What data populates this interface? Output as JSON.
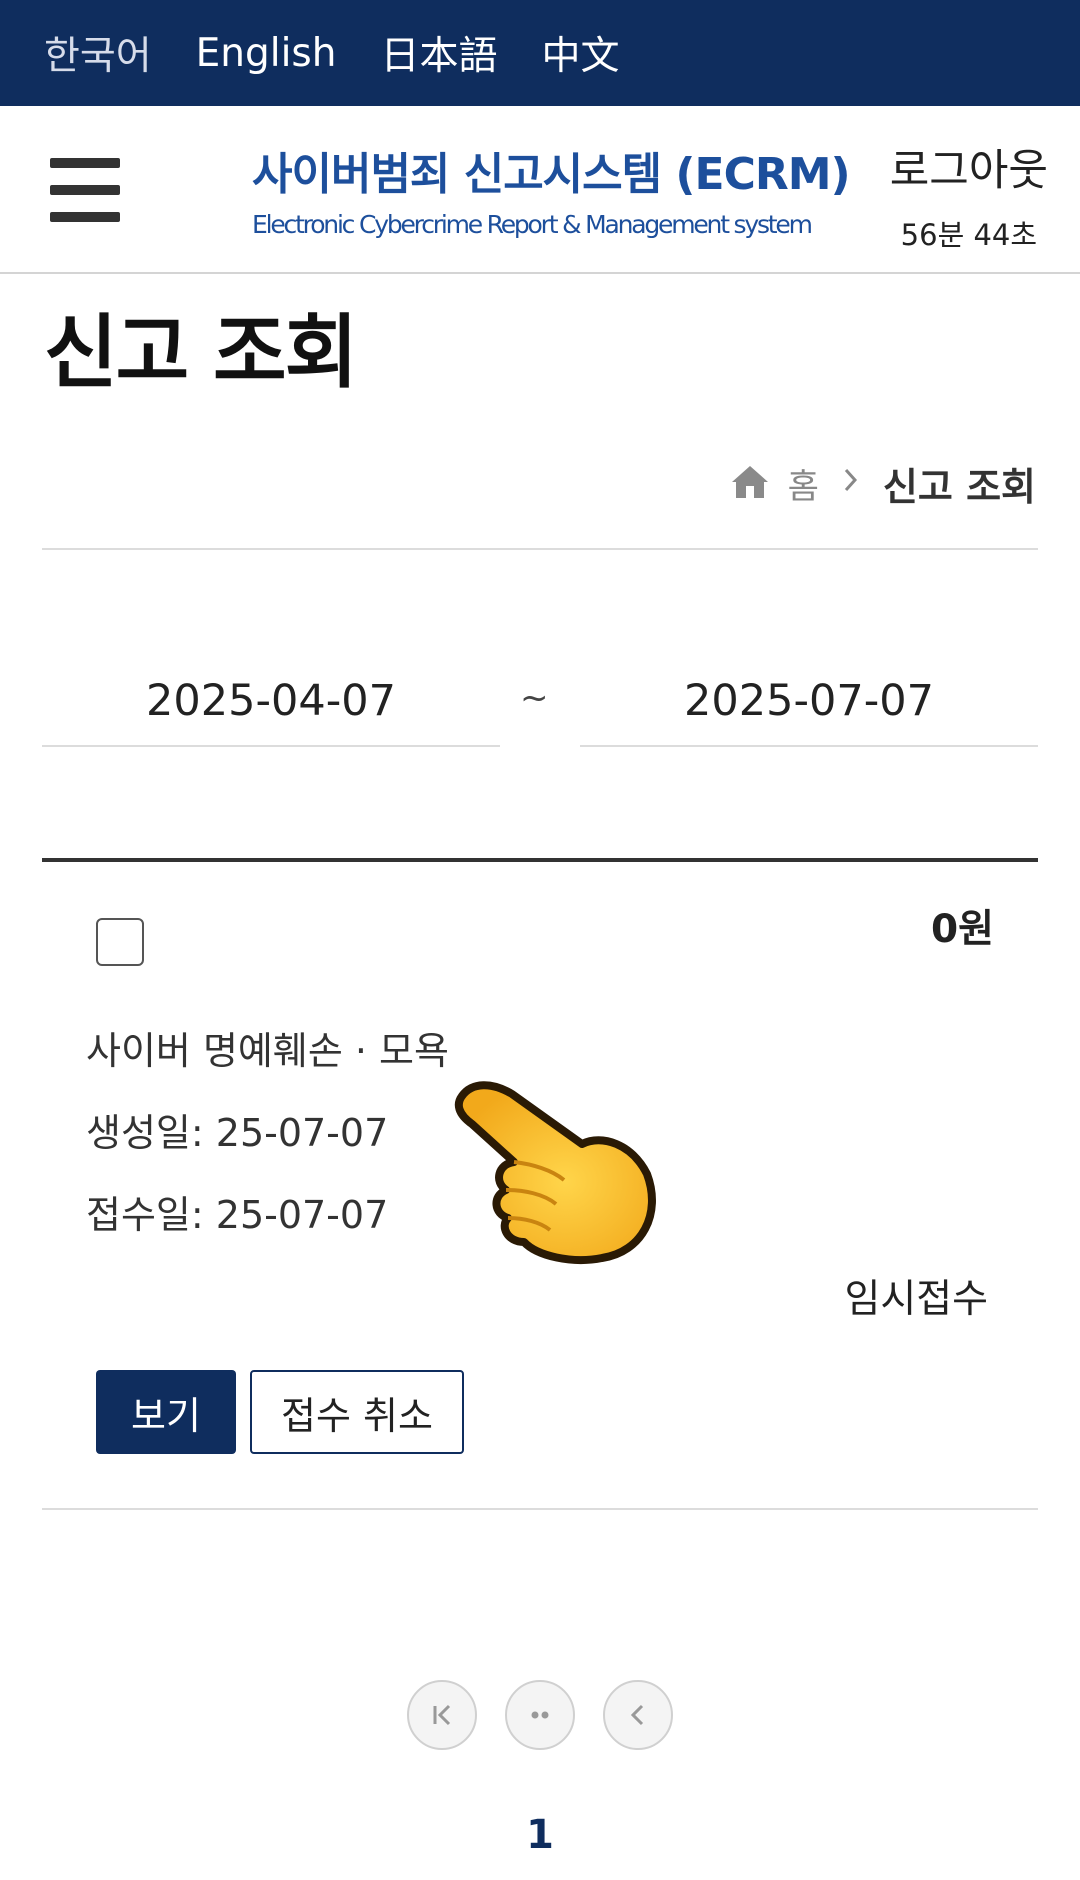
{
  "languages": [
    "한국어",
    "English",
    "日本語",
    "中文"
  ],
  "header": {
    "brand_title": "사이버범죄 신고시스템 (ECRM)",
    "brand_subtitle": "Electronic Cybercrime Report & Management system",
    "logout_label": "로그아웃",
    "session_timer": "56분 44초"
  },
  "page": {
    "title": "신고 조회",
    "breadcrumb": {
      "home": "홈",
      "current": "신고 조회"
    }
  },
  "filter": {
    "start_date": "2025-04-07",
    "separator": "~",
    "end_date": "2025-07-07"
  },
  "report": {
    "amount": "0원",
    "category": "사이버 명예훼손 · 모욕",
    "created": "생성일: 25-07-07",
    "received": "접수일: 25-07-07",
    "status": "임시접수",
    "view_label": "보기",
    "cancel_label": "접수 취소"
  },
  "pagination": {
    "current_page": "1"
  },
  "colors": {
    "navy": "#0f2d5e",
    "brand_blue": "#1d4f9c"
  },
  "icons": [
    "hamburger-menu-icon",
    "home-icon",
    "chevron-right-icon",
    "first-page-icon",
    "more-pages-icon",
    "prev-page-icon",
    "pointing-hand-emoji"
  ]
}
